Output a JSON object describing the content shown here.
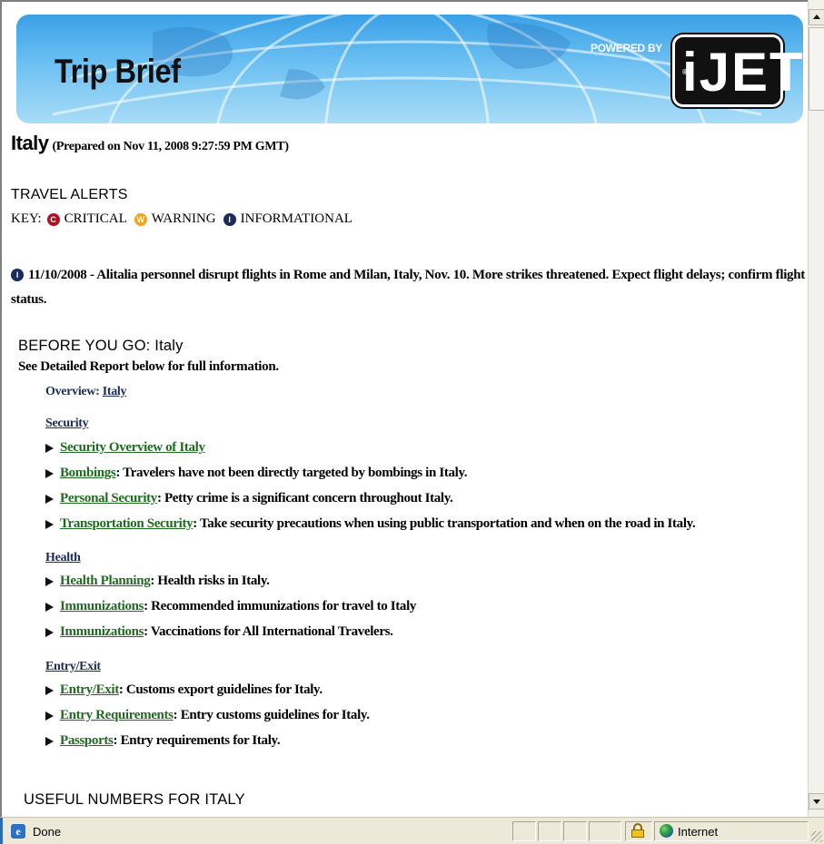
{
  "banner": {
    "title": "Trip Brief",
    "powered_by": "POWERED BY",
    "logo_text": "iJET",
    "logo_reg": "®"
  },
  "header": {
    "country": "Italy",
    "prepared": "(Prepared on Nov 11, 2008 9:27:59 PM GMT)"
  },
  "travel_alerts": {
    "title": "TRAVEL ALERTS",
    "key_label": "KEY:",
    "key_items": [
      {
        "icon": "C",
        "label": "CRITICAL",
        "color": "#b01020"
      },
      {
        "icon": "W",
        "label": "WARNING",
        "color": "#f2a31a"
      },
      {
        "icon": "I",
        "label": "INFORMATIONAL",
        "color": "#1a2c5c"
      }
    ],
    "alert": {
      "icon": "I",
      "text": "11/10/2008 - Alitalia personnel disrupt flights in Rome and Milan, Italy, Nov. 10. More strikes threatened. Expect flight delays; confirm flight status."
    }
  },
  "before_you_go": {
    "title": "BEFORE YOU GO: Italy",
    "note": "See Detailed Report below for full information.",
    "overview_label": "Overview:",
    "overview_link": "Italy",
    "categories": [
      {
        "title": "Security",
        "items": [
          {
            "link": "Security Overview of Italy",
            "text": ""
          },
          {
            "link": "Bombings",
            "text": ": Travelers have not been directly targeted by bombings in Italy."
          },
          {
            "link": "Personal Security",
            "text": ": Petty crime is a significant concern throughout Italy."
          },
          {
            "link": "Transportation Security",
            "text": ": Take security precautions when using public transportation and when on the road in Italy."
          }
        ]
      },
      {
        "title": "Health",
        "items": [
          {
            "link": "Health Planning",
            "text": ": Health risks in Italy."
          },
          {
            "link": "Immunizations",
            "text": ": Recommended immunizations for travel to Italy"
          },
          {
            "link": "Immunizations",
            "text": ": Vaccinations for All International Travelers."
          }
        ]
      },
      {
        "title": "Entry/Exit",
        "items": [
          {
            "link": "Entry/Exit",
            "text": ": Customs export guidelines for Italy."
          },
          {
            "link": "Entry Requirements",
            "text": ": Entry customs guidelines for Italy."
          },
          {
            "link": "Passports",
            "text": ": Entry requirements for Italy."
          }
        ]
      }
    ]
  },
  "useful_numbers": {
    "title": "USEFUL NUMBERS FOR ITALY"
  },
  "status_bar": {
    "status": "Done",
    "zone": "Internet"
  },
  "colors": {
    "link_green": "#1f6b1f",
    "heading_navy": "#1a2c5c",
    "critical": "#b01020",
    "warning": "#f2a31a",
    "informational": "#1a2c5c"
  }
}
